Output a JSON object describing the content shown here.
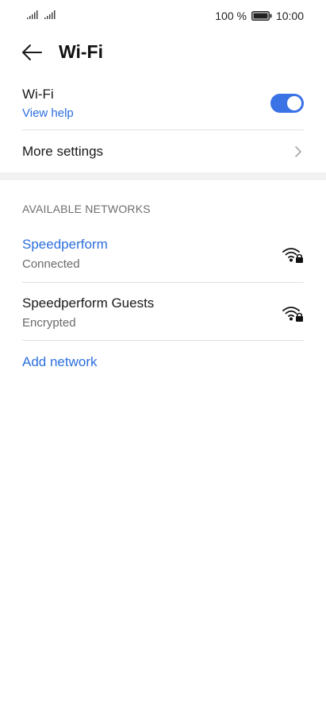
{
  "status_bar": {
    "battery_text": "100 %",
    "time": "10:00"
  },
  "header": {
    "title": "Wi-Fi"
  },
  "wifi_toggle": {
    "label": "Wi-Fi",
    "help_link": "View help",
    "enabled": true,
    "accent_color": "#3a73e6"
  },
  "more_settings": {
    "label": "More settings"
  },
  "networks": {
    "section_title": "AVAILABLE NETWORKS",
    "items": [
      {
        "name": "Speedperform",
        "status": "Connected",
        "connected": true,
        "icon": "wifi-lock-icon"
      },
      {
        "name": "Speedperform Guests",
        "status": "Encrypted",
        "connected": false,
        "icon": "wifi-lock-icon"
      }
    ],
    "add_label": "Add network"
  },
  "colors": {
    "link": "#2c6fde",
    "text": "#1a1a1a",
    "secondary_text": "#6a6a6a"
  }
}
